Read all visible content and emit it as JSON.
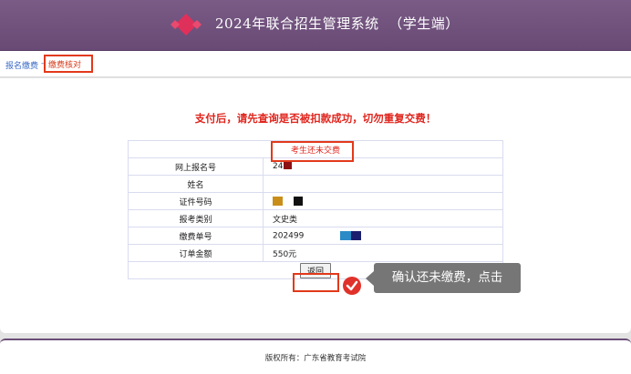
{
  "header": {
    "title": "2024年联合招生管理系统  （学生端）"
  },
  "breadcrumb": {
    "link": "报名缴费",
    "separator": "-",
    "current": "缴费核对"
  },
  "main": {
    "warning": "支付后，请先查询是否被扣款成功，切勿重复交费！",
    "status": "考生还未交费",
    "rows": [
      {
        "label": "网上报名号",
        "value": "24"
      },
      {
        "label": "姓名",
        "value": ""
      },
      {
        "label": "证件号码",
        "value": ""
      },
      {
        "label": "报考类别",
        "value": "文史类"
      },
      {
        "label": "缴费单号",
        "value": "202499"
      },
      {
        "label": "订单金额",
        "value": "550元"
      }
    ],
    "back_button": "返回"
  },
  "tooltip": {
    "text": "确认还未缴费，点击"
  },
  "footer": {
    "text": "版权所有：广东省教育考试院"
  },
  "colors": {
    "header": "#6b4d78",
    "highlight": "#e2391a",
    "warning": "#e0251d",
    "link": "#3a6bc7"
  }
}
